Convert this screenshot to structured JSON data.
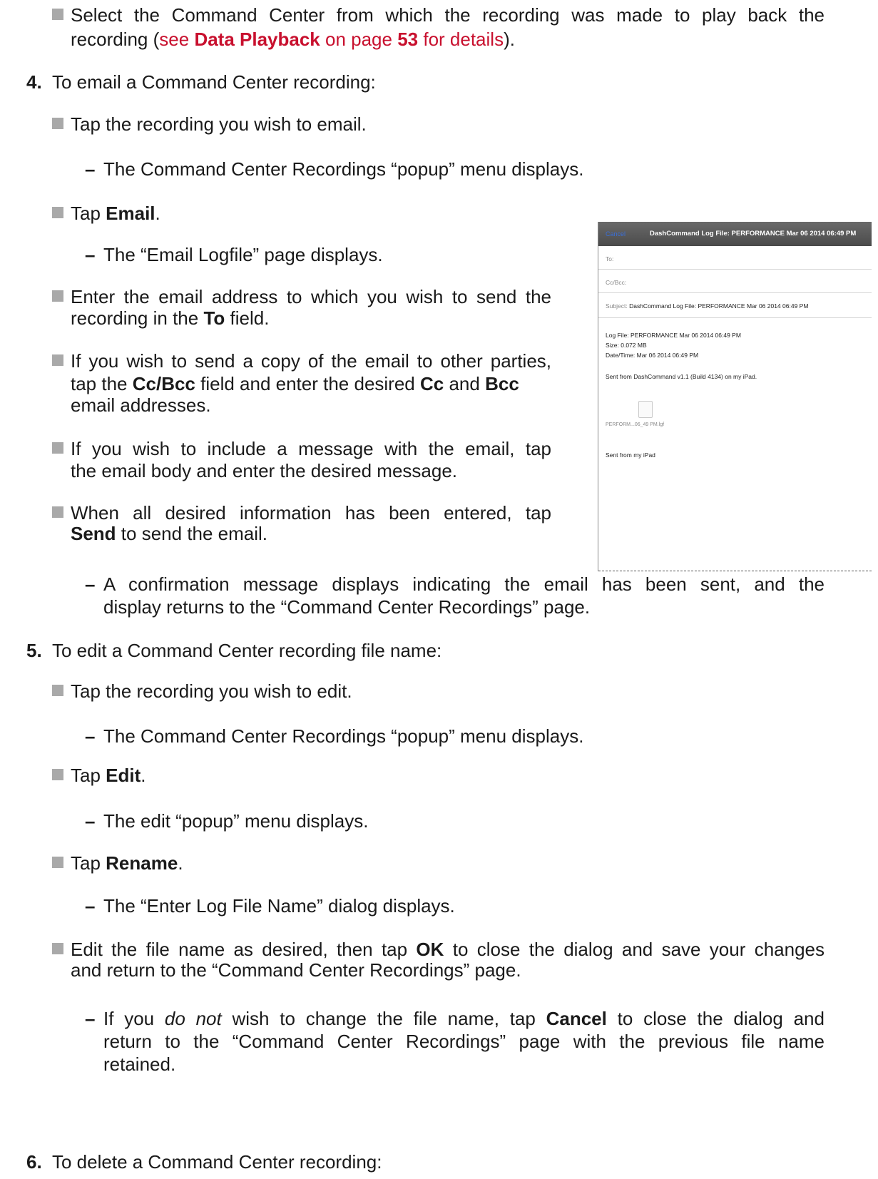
{
  "intro_bullet": {
    "line1": "Select the Command Center from which the recording was made to play back the",
    "line2_pre": "recording (",
    "ref_see": "see ",
    "ref_link": "Data Playback",
    "ref_on": " on page ",
    "ref_page": "53",
    "ref_for": " for details",
    "line2_post": ")."
  },
  "step4": {
    "number": "4.",
    "text": "To email a Command Center recording:",
    "b1": "Tap the recording you wish to email.",
    "b1_sub": "The Command Center Recordings “popup” menu displays.",
    "b2_pre": "Tap ",
    "b2_bold": "Email",
    "b2_post": ".",
    "b2_sub": "The “Email Logfile” page displays.",
    "b3_line1": "Enter the email address to which you wish to send the",
    "b3_line2_pre": "recording in the ",
    "b3_bold": "To",
    "b3_line2_post": " field.",
    "b4_line1": "If you wish to send a copy of the email to other parties,",
    "b4_l2_pre": "tap the ",
    "b4_bold1": "Cc/Bcc",
    "b4_l2_mid": " field and enter the desired ",
    "b4_bold2": "Cc",
    "b4_l2_and": " and ",
    "b4_bold3": "Bcc",
    "b4_line3": "email addresses.",
    "b5_line1": "If you wish to include a message with the email, tap",
    "b5_line2": "the email body and enter the desired message.",
    "b6_line1": "When all desired information has been entered, tap",
    "b6_bold": "Send",
    "b6_line2_post": " to send the email.",
    "b6_sub_line1": "A confirmation message displays indicating the email has been sent, and the",
    "b6_sub_line2": "display returns to the “Command Center Recordings” page."
  },
  "step5": {
    "number": "5.",
    "text": "To edit a Command Center recording file name:",
    "b1": "Tap the recording you wish to edit.",
    "b1_sub": "The Command Center Recordings “popup” menu displays.",
    "b2_pre": "Tap ",
    "b2_bold": "Edit",
    "b2_post": ".",
    "b2_sub": "The edit “popup” menu displays.",
    "b3_pre": "Tap ",
    "b3_bold": "Rename",
    "b3_post": ".",
    "b3_sub": "The “Enter Log File Name” dialog displays.",
    "b4_line1_pre": "Edit the file name as desired, then tap ",
    "b4_bold": "OK",
    "b4_line1_post": " to close the dialog and save your changes",
    "b4_line2": "and return to the “Command Center Recordings” page.",
    "b4_sub_pre": "If you ",
    "b4_sub_em": "do not",
    "b4_sub_mid": " wish to change the file name, tap ",
    "b4_sub_bold": "Cancel",
    "b4_sub_post": " to close the dialog and",
    "b4_sub_line2": "return to the “Command Center Recordings” page with the previous file name",
    "b4_sub_line3": "retained."
  },
  "step6": {
    "number": "6.",
    "text": "To delete a Command Center recording:"
  },
  "screenshot": {
    "cancel": "Cancel",
    "title": "DashCommand Log File: PERFORMANCE Mar 06 2014 06:49 PM",
    "to_label": "To:",
    "cc_label": "Cc/Bcc:",
    "subject_label": "Subject:",
    "subject_value": "DashCommand Log File: PERFORMANCE Mar 06 2014 06:49 PM",
    "body_line1": "Log File: PERFORMANCE Mar 06 2014 06:49 PM",
    "body_line2": "Size: 0.072 MB",
    "body_line3": "Date/Time: Mar 06 2014 06:49 PM",
    "body_line4": "Sent from DashCommand v1.1 (Build 4134) on my iPad.",
    "attachment_name": "PERFORM...06_49 PM.lgf",
    "signature": "Sent from my iPad"
  }
}
